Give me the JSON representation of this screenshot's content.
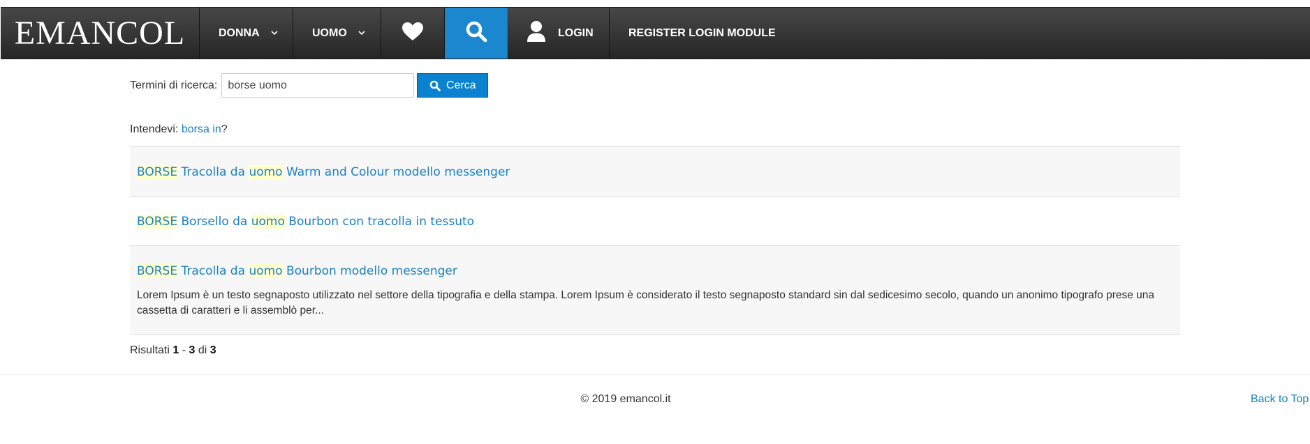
{
  "brand": "EMANCOL",
  "nav": {
    "donna": "DONNA",
    "uomo": "UOMO",
    "login": "LOGIN",
    "register": "REGISTER LOGIN MODULE"
  },
  "search": {
    "label": "Termini di ricerca:",
    "value": "borse uomo",
    "button": "Cerca"
  },
  "suggestion": {
    "prefix": "Intendevi:",
    "link": "borsa in",
    "suffix": "?"
  },
  "results": [
    {
      "cat": "BORSE",
      "t1": "Tracolla da",
      "kw": "uomo",
      "t2": "Warm and Colour modello messenger"
    },
    {
      "cat": "BORSE",
      "t1": "Borsello da",
      "kw": "uomo",
      "t2": "Bourbon con tracolla in tessuto"
    },
    {
      "cat": "BORSE",
      "t1": "Tracolla da",
      "kw": "uomo",
      "t2": "Bourbon modello messenger",
      "desc": "Lorem Ipsum è un testo segnaposto utilizzato nel settore della tipografia e della stampa. Lorem Ipsum è considerato il testo segnaposto standard sin dal sedicesimo secolo, quando un anonimo tipografo prese una cassetta di caratteri e li assemblò per..."
    }
  ],
  "pager": {
    "label": "Risultati",
    "from": "1",
    "sep": "-",
    "to": "3",
    "of": "di",
    "total": "3"
  },
  "footer": {
    "copyright": "© 2019 emancol.it",
    "back_to_top": "Back to Top"
  },
  "colors": {
    "nav_bg": "#333333",
    "accent": "#1a87cf",
    "link": "#1a80c4",
    "highlight": "#ffffcc"
  },
  "icons": [
    "heart-icon",
    "search-icon",
    "user-icon",
    "chevron-down-icon"
  ]
}
